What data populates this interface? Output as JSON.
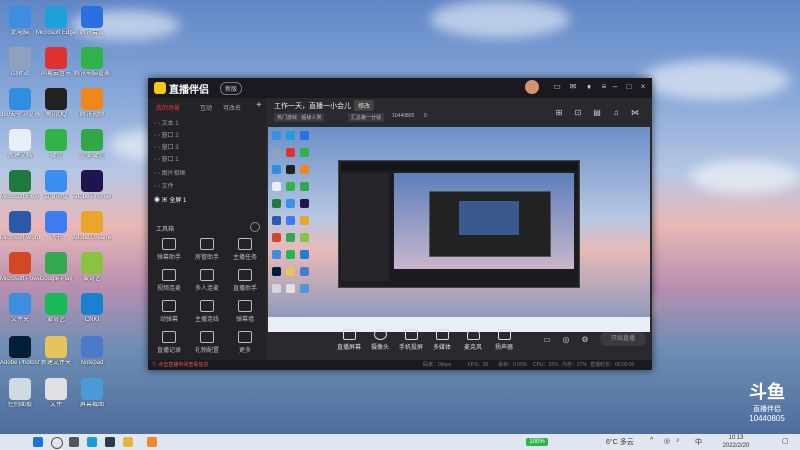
{
  "desktop": {
    "icons": [
      {
        "label": "此电脑",
        "color": "#3d8ee0"
      },
      {
        "label": "Microsoft Edge",
        "color": "#1fa0d8"
      },
      {
        "label": "腾讯会议",
        "color": "#2b6fe0"
      },
      {
        "label": "回收站",
        "color": "#8ea2be"
      },
      {
        "label": "网易云音乐",
        "color": "#e03131"
      },
      {
        "label": "腾讯电脑管家",
        "color": "#2fb44a"
      },
      {
        "label": "360安全浏览器",
        "color": "#2f8ee0"
      },
      {
        "label": "腾讯QQ",
        "color": "#222222"
      },
      {
        "label": "腾讯视频",
        "color": "#f0871c"
      },
      {
        "label": "新建文档",
        "color": "#e8eef6"
      },
      {
        "label": "微信",
        "color": "#2fb44a"
      },
      {
        "label": "企业微信",
        "color": "#2fa84a"
      },
      {
        "label": "Microsoft Excel 2010",
        "color": "#1f7a42"
      },
      {
        "label": "百度网盘",
        "color": "#3a8ef0"
      },
      {
        "label": "Adobe Premiere Pro",
        "color": "#1e1450"
      },
      {
        "label": "Microsoft Word 2010",
        "color": "#2b5aa8"
      },
      {
        "label": "飞书",
        "color": "#3c7cf0"
      },
      {
        "label": "Adobe Dreamweaver",
        "color": "#e8a62a"
      },
      {
        "label": "Microsoft PowerPoint",
        "color": "#d24726"
      },
      {
        "label": "Google Play",
        "color": "#34a853"
      },
      {
        "label": "爱奇艺",
        "color": "#8ac43f"
      },
      {
        "label": "文件夹",
        "color": "#3d8ee0"
      },
      {
        "label": "爱奇艺",
        "color": "#19b955"
      },
      {
        "label": "CNKI",
        "color": "#1a80d0"
      },
      {
        "label": "Adobe Photoshop",
        "color": "#001e36"
      },
      {
        "label": "新建文件夹",
        "color": "#e8c25a"
      },
      {
        "label": "Notepad",
        "color": "#4a7ac8"
      },
      {
        "label": "控制面板",
        "color": "#d0d8e0"
      },
      {
        "label": "文件",
        "color": "#e0e0e0"
      },
      {
        "label": "屏幕截图",
        "color": "#4a9ad8"
      }
    ]
  },
  "app": {
    "title": "直播伴侣",
    "badge": "新版",
    "tabs": [
      "我的场景",
      "互动",
      "可改名"
    ],
    "add_tab": "+",
    "stream_title": "工作一天，直播一小会儿",
    "stream_title_btn": "修改",
    "tags": [
      "热门游戏 · 超级人类",
      "汇总第一分钱",
      "10440805"
    ],
    "live_count": "0",
    "scenes": [
      "文本 1",
      "窗口 2",
      "窗口 3",
      "窗口 1",
      "图片相框",
      "文件"
    ],
    "active_source": "全屏 1",
    "tool_section": "工具箱",
    "tools": [
      "弹幕助手",
      "房管助手",
      "主播任务",
      "视频连麦",
      "多人连麦",
      "直播助手",
      "动弹幕",
      "主播连线",
      "弹幕墙",
      "直播记录",
      "礼物配置",
      "更多"
    ],
    "bottom": [
      "直播屏幕",
      "摄像头",
      "手机投屏",
      "多媒体",
      "麦克风",
      "扬声器"
    ],
    "start_btn": "开始直播",
    "footer_left": "① 点击直播中间查看信息",
    "footer_right": [
      "码率：0kbps",
      "FPS：30",
      "丢帧：0.00%",
      "CPU：35%",
      "内存：57%",
      "直播时长：00:00:00"
    ]
  },
  "douyu": {
    "logo": "斗鱼",
    "sub": "直播伴侣",
    "id": "10440805"
  },
  "taskbar": {
    "weather": "6°C 多云",
    "battery": "100%",
    "lang": "中",
    "time": "10:13",
    "date": "2022/2/20"
  }
}
